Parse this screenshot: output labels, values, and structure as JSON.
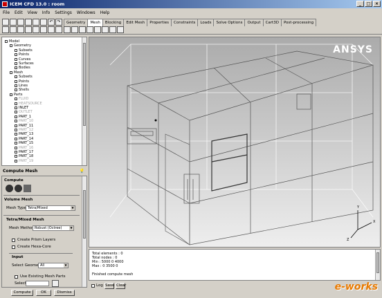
{
  "window": {
    "title": "ICEM CFD 13.0 : room"
  },
  "menu": [
    "File",
    "Edit",
    "View",
    "Info",
    "Settings",
    "Windows",
    "Help"
  ],
  "tabs": [
    "Geometry",
    "Mesh",
    "Blocking",
    "Edit Mesh",
    "Properties",
    "Constraints",
    "Loads",
    "Solve Options",
    "Output",
    "Cart3D",
    "Post-processing"
  ],
  "active_tab": "Mesh",
  "tree": {
    "items": [
      {
        "label": "Model",
        "grey": false
      },
      {
        "label": "Geometry",
        "grey": false
      },
      {
        "label": "Subsets",
        "grey": false
      },
      {
        "label": "Points",
        "grey": false
      },
      {
        "label": "Curves",
        "grey": false
      },
      {
        "label": "Surfaces",
        "grey": false
      },
      {
        "label": "Bodies",
        "grey": false
      },
      {
        "label": "Mesh",
        "grey": false
      },
      {
        "label": "Subsets",
        "grey": false
      },
      {
        "label": "Points",
        "grey": false
      },
      {
        "label": "Lines",
        "grey": false
      },
      {
        "label": "Shells",
        "grey": false
      },
      {
        "label": "Parts",
        "grey": false
      },
      {
        "label": "FLUID",
        "grey": true
      },
      {
        "label": "HEATSOURCE",
        "grey": true
      },
      {
        "label": "INLET",
        "grey": false
      },
      {
        "label": "OUTLET",
        "grey": true
      },
      {
        "label": "PART_1",
        "grey": false
      },
      {
        "label": "PART_10",
        "grey": true
      },
      {
        "label": "PART_11",
        "grey": false
      },
      {
        "label": "PART_12",
        "grey": true
      },
      {
        "label": "PART_13",
        "grey": false
      },
      {
        "label": "PART_14",
        "grey": false
      },
      {
        "label": "PART_15",
        "grey": false
      },
      {
        "label": "PART_16",
        "grey": true
      },
      {
        "label": "PART_17",
        "grey": false
      },
      {
        "label": "PART_18",
        "grey": false
      },
      {
        "label": "PART_19",
        "grey": true
      }
    ]
  },
  "compute": {
    "header": "Compute Mesh",
    "section_label": "Compute",
    "volume_mesh_label": "Volume Mesh",
    "mesh_type_label": "Mesh Type",
    "mesh_type_value": "Tetra/Mixed",
    "tetra_mixed_label": "Tetra/Mixed Mesh",
    "mesh_method_label": "Mesh Method",
    "mesh_method_value": "Robust (Octree)",
    "create_prism_label": "Create Prism Layers",
    "create_hexa_label": "Create Hexa-Core",
    "input_label": "Input",
    "select_geometry_label": "Select Geometry",
    "select_geometry_value": "All",
    "use_existing_label": "Use Existing Mesh Parts",
    "select_label": "Select",
    "buttons": {
      "compute": "Compute",
      "ok": "OK",
      "dismiss": "Dismiss"
    }
  },
  "viewport": {
    "logo": "ANSYS"
  },
  "messages": {
    "lines": [
      "Total elements : 0",
      "Total nodes : 0",
      "Min : 5000 0 4000",
      "Max : 0 3500 0",
      "",
      "Finished compute mesh"
    ],
    "log_label": "Log",
    "save_label": "Save",
    "clear_label": "Clear"
  },
  "watermark": "e-works",
  "colors": {
    "title_gradient_start": "#0a246a",
    "title_gradient_end": "#a6caf0",
    "viewport_top": "#ababab",
    "viewport_bottom": "#eeeeee"
  }
}
